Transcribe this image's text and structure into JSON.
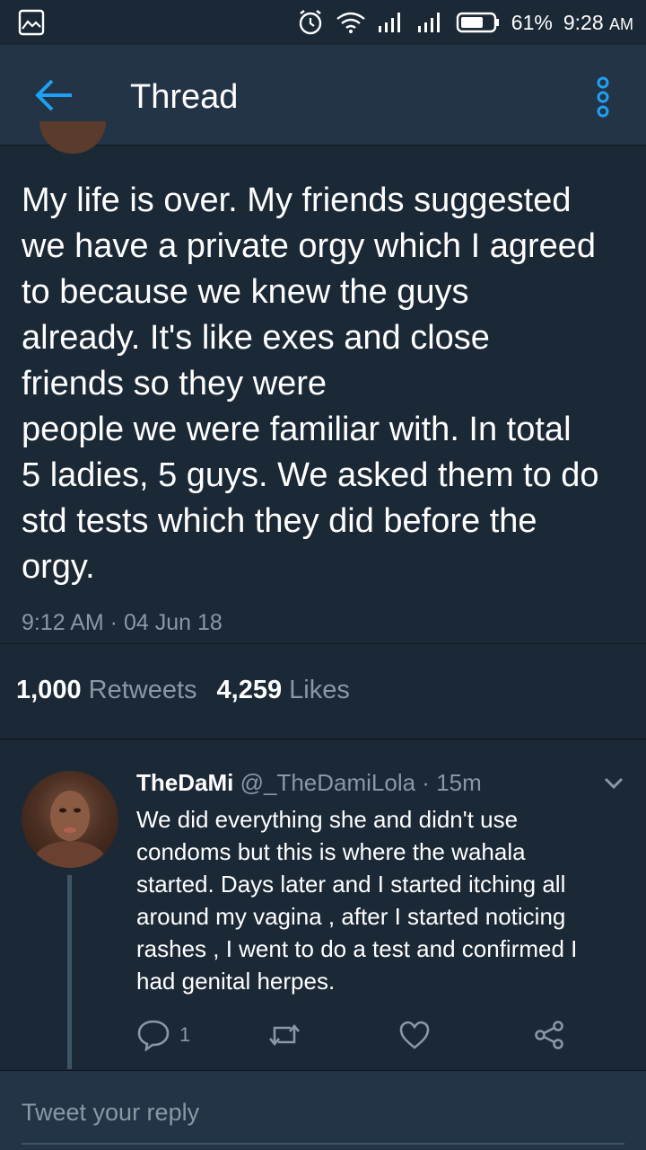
{
  "status_bar": {
    "battery": "61%",
    "time": "9:28",
    "ampm": "AM",
    "icons": [
      "gallery-icon",
      "alarm-icon",
      "wifi-icon",
      "signal-icon",
      "signal-icon",
      "battery-icon"
    ]
  },
  "app_bar": {
    "title": "Thread",
    "back_icon": "arrow-left-icon",
    "menu_icon": "more-vertical-icon",
    "accent": "#1da1f2"
  },
  "main_tweet": {
    "text": "My life is over. My friends suggested\nwe have a private orgy which I agreed\nto because we knew the guys\nalready. It's like exes and close\nfriends so they were\npeople we were familiar with. In total\n5 ladies, 5 guys. We asked them to do\nstd tests which they did before the\norgy.",
    "timestamp": "9:12 AM · 04 Jun 18"
  },
  "stats": {
    "retweets_count": "1,000",
    "retweets_label": "Retweets",
    "likes_count": "4,259",
    "likes_label": "Likes"
  },
  "reply": {
    "name": "TheDaMi",
    "handle": "@_TheDamiLola",
    "separator": "·",
    "time": "15m",
    "text": "We did everything she and didn't use\ncondoms but this is where the wahala\nstarted. Days later and I started itching all\naround my vagina , after I started noticing\nrashes , I went to do a test and confirmed I\nhad genital herpes.",
    "reply_count": "1"
  },
  "compose": {
    "placeholder": "Tweet your reply"
  },
  "colors": {
    "background": "#1b2836",
    "header": "#243447",
    "secondary_text": "#8899a6"
  }
}
